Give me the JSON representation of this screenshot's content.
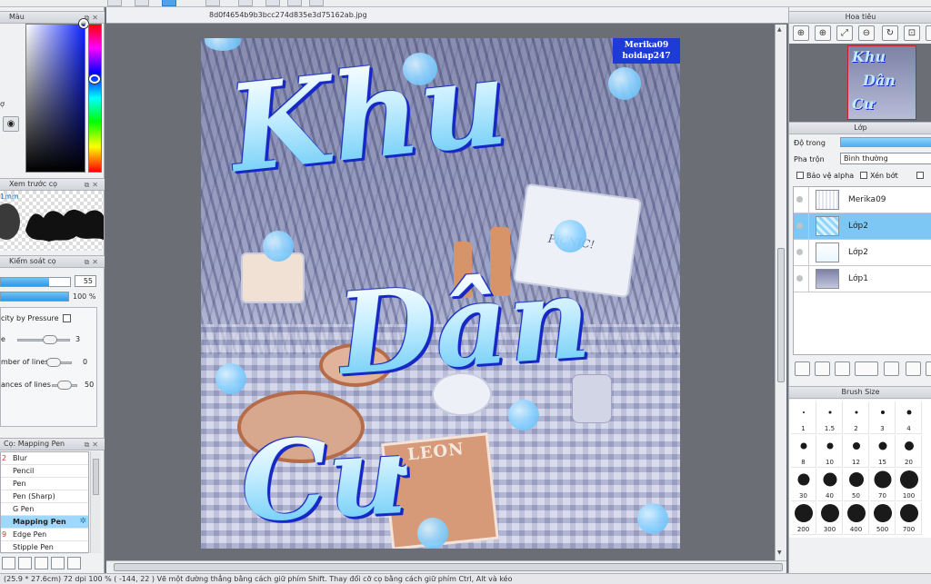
{
  "document": {
    "filename": "8d0f4654b9b3bcc274d835e3d75162ab.jpg"
  },
  "color_panel": {
    "title": "Màu",
    "side_label": "ợ"
  },
  "brush_preview": {
    "title": "Xem trước cọ",
    "size": "1mm"
  },
  "brush_control": {
    "title": "Kiểm soát cọ",
    "size_value": "55",
    "opacity_value": "100 %",
    "pressure_label": "city by Pressure",
    "row1_label": "e",
    "row1_value": "3",
    "row2_label": "mber of lines",
    "row2_value": "0",
    "row3_label": "ances of lines",
    "row3_value": "50"
  },
  "tools": {
    "title": "Cọ: Mapping Pen",
    "items": [
      {
        "num": "2",
        "label": "Blur"
      },
      {
        "num": "",
        "label": "Pencil"
      },
      {
        "num": "",
        "label": "Pen"
      },
      {
        "num": "",
        "label": "Pen (Sharp)"
      },
      {
        "num": "",
        "label": "G Pen"
      },
      {
        "num": "",
        "label": "Mapping Pen"
      },
      {
        "num": "9",
        "label": "Edge Pen"
      },
      {
        "num": "",
        "label": "Stipple Pen"
      }
    ],
    "selected_index": 5
  },
  "artwork": {
    "watermark_line1": "Merika09",
    "watermark_line2": "hoidap247",
    "word1": "Khu",
    "word2": "Dân",
    "word3": "Cư",
    "book_title": "LEON",
    "box_text": "PICNIC!"
  },
  "navigator": {
    "title": "Hoa tiêu"
  },
  "layers": {
    "title": "Lớp",
    "opacity_label": "Độ trong",
    "blend_label": "Pha trộn",
    "blend_value": "Bình thường",
    "opt_alpha": "Bảo vệ alpha",
    "opt_clip": "Xén bớt",
    "items": [
      {
        "name": "Merika09",
        "selected": false
      },
      {
        "name": "Lớp2",
        "selected": true
      },
      {
        "name": "Lớp2",
        "selected": false
      },
      {
        "name": "Lớp1",
        "selected": false
      }
    ]
  },
  "brush_size": {
    "title": "Brush Size",
    "sizes": [
      "1",
      "1.5",
      "2",
      "3",
      "4",
      "8",
      "10",
      "12",
      "15",
      "20",
      "30",
      "40",
      "50",
      "70",
      "100",
      "200",
      "300",
      "400",
      "500",
      "700"
    ]
  },
  "status": {
    "text": "(25.9 * 27.6cm)  72 dpi  100 %  ( -144, 22 )  Vẽ một đường thẳng bằng cách giữ phím Shift. Thay đổi cỡ cọ bằng cách giữ phím Ctrl, Alt và kéo"
  },
  "colors": {
    "accent": "#4fb0ef",
    "selection": "#7cc7f4",
    "text_blue": "#1528c6"
  }
}
